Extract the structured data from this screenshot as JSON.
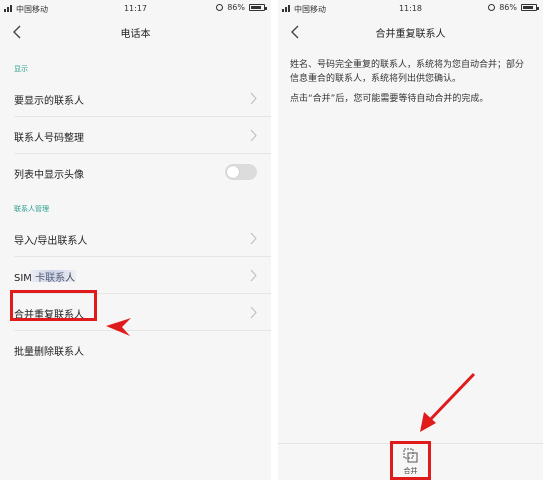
{
  "colors": {
    "accent": "#2a9d8f",
    "annotation_red": "#e01b1b",
    "background": "#f6f6f6"
  },
  "left": {
    "status": {
      "carrier": "中国移动",
      "time": "11:17",
      "battery": "86%"
    },
    "title": "电话本",
    "sections": [
      {
        "header": "显示",
        "items": [
          {
            "label": "要显示的联系人",
            "control": "chevron-right-icon"
          },
          {
            "label": "联系人号码整理",
            "control": "chevron-right-icon"
          },
          {
            "label": "列表中显示头像",
            "control": "toggle",
            "toggle_on": false
          }
        ]
      },
      {
        "header": "联系人管理",
        "items": [
          {
            "label": "导入/导出联系人",
            "control": "chevron-right-icon"
          },
          {
            "label": "SIM 卡联系人",
            "control": "chevron-right-icon"
          },
          {
            "label": "合并重复联系人",
            "control": "chevron-right-icon",
            "highlighted": true
          },
          {
            "label": "批量删除联系人",
            "control": "none"
          }
        ]
      }
    ]
  },
  "right": {
    "status": {
      "carrier": "中国移动",
      "time": "11:18",
      "battery": "86%"
    },
    "title": "合并重复联系人",
    "description_1": "姓名、号码完全重复的联系人，系统将为您自动合并；部分信息重合的联系人，系统将列出供您确认。",
    "description_2": "点击“合并”后，您可能需要等待自动合并的完成。",
    "merge_button": {
      "label": "合并",
      "icon": "merge-icon"
    }
  },
  "battery_level": 0.86
}
